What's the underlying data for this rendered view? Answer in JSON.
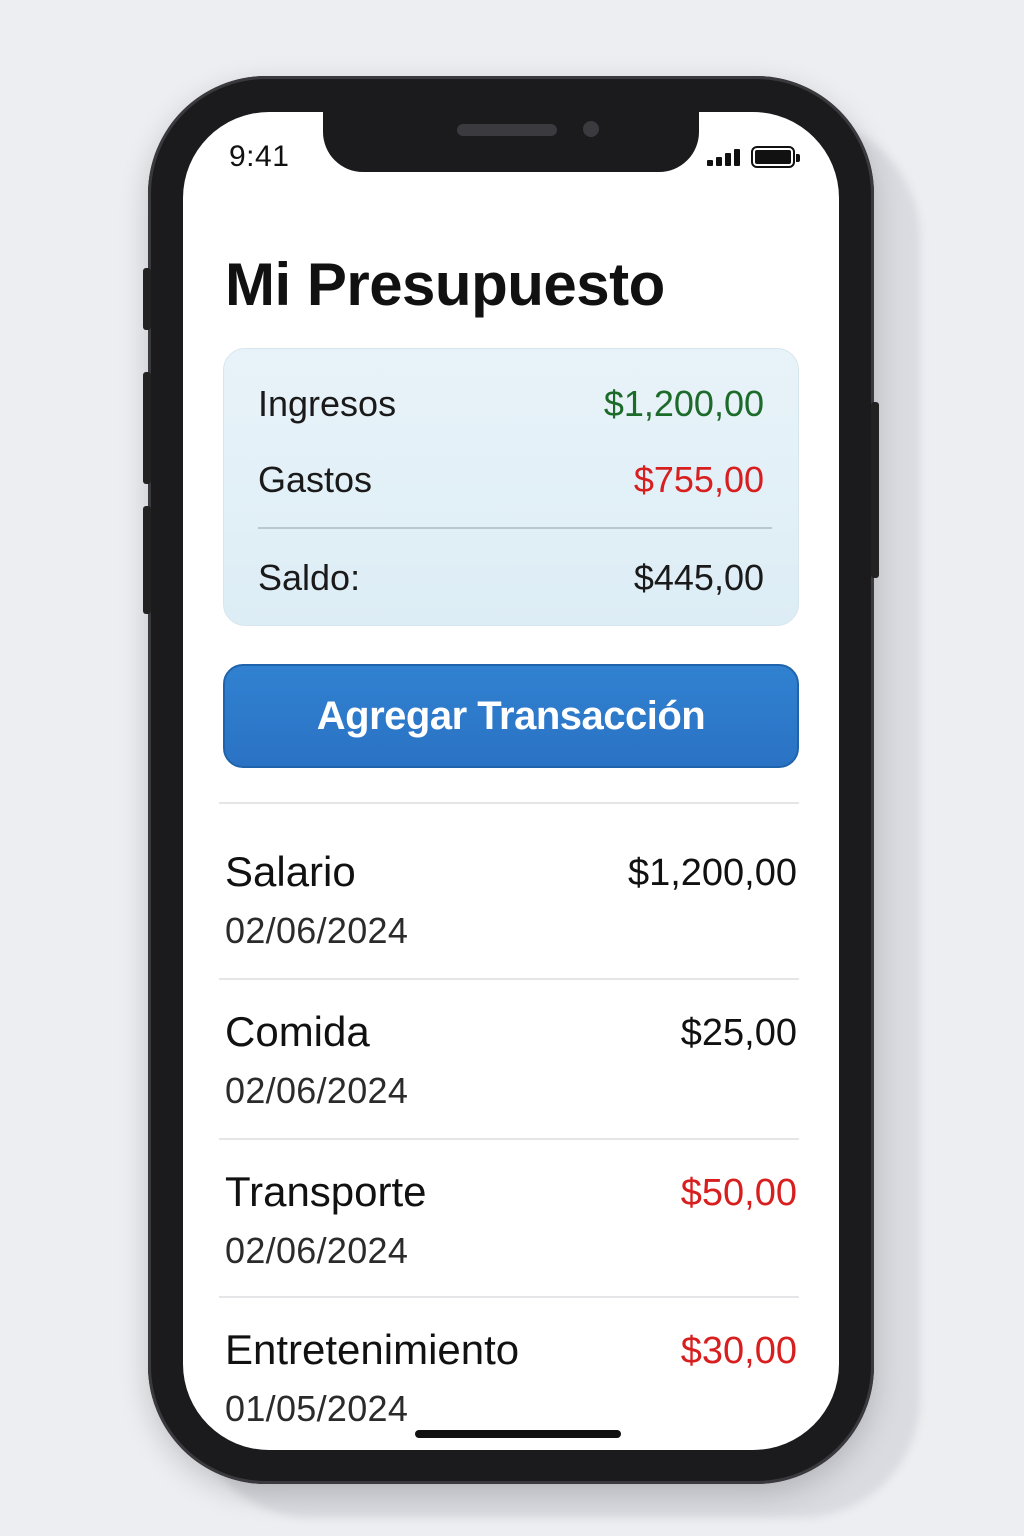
{
  "status_bar": {
    "time": "9:41"
  },
  "header": {
    "title": "Mi Presupuesto"
  },
  "summary": {
    "income_label": "Ingresos",
    "income_value": "$1,200,00",
    "expense_label": "Gastos",
    "expense_value": "$755,00",
    "balance_label": "Saldo:",
    "balance_value": "$445,00"
  },
  "actions": {
    "add_transaction_label": "Agregar Transacción"
  },
  "transactions": [
    {
      "name": "Salario",
      "date": "02/06/2024",
      "amount": "$1,200,00",
      "amount_color": "#111111"
    },
    {
      "name": "Comida",
      "date": "02/06/2024",
      "amount": "$25,00",
      "amount_color": "#111111"
    },
    {
      "name": "Transporte",
      "date": "02/06/2024",
      "amount": "$50,00",
      "amount_color": "#d81f1f"
    },
    {
      "name": "Entretenimiento",
      "date": "01/05/2024",
      "amount": "$30,00",
      "amount_color": "#d81f1f"
    }
  ],
  "colors": {
    "income": "#1d6b2a",
    "expense": "#d81f1f",
    "accent": "#2a72c4"
  }
}
